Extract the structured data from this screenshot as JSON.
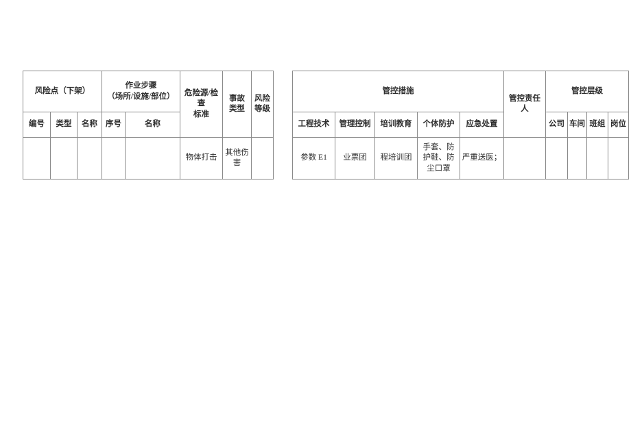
{
  "document": {
    "type": "risk-control-table",
    "background_color": "#ffffff",
    "border_color": "#8a8a8a",
    "text_color": "#2e2e2e"
  },
  "left_table": {
    "name": "risk-point-table",
    "headers": {
      "risk_point_group": "风险点（下架）",
      "risk_point_sub": [
        "编号",
        "类型",
        "名称"
      ],
      "work_step_group": "作业步骤\n（场所/设施/部位）",
      "work_step_group_line1": "作业步骤",
      "work_step_group_line2": "（场所/设施/部位）",
      "work_step_sub": [
        "序号",
        "名称"
      ],
      "hazard_source": "危险源/检查标准",
      "hazard_source_line1": "危险源/检查",
      "hazard_source_line2": "标准",
      "accident_type": "事故类型",
      "accident_type_line1": "事故",
      "accident_type_line2": "类型",
      "risk_level": "风险等级",
      "risk_level_line1": "风险",
      "risk_level_line2": "等级"
    },
    "rows": [
      {
        "number": "",
        "category": "",
        "name": "",
        "step_no": "",
        "step_name": "",
        "hazard_source": "物体打击",
        "accident_type": "其他伤害",
        "risk_level": ""
      }
    ]
  },
  "right_table": {
    "name": "control-measures-table",
    "headers": {
      "control_measures_group": "管控措施",
      "control_measures_sub": [
        "工程技术",
        "管理控制",
        "培训教育",
        "个体防护",
        "应急处置"
      ],
      "responsible_person": "管控责任人",
      "control_level_group": "管控层级",
      "control_level_sub": [
        "公司",
        "车间",
        "班组",
        "岗位"
      ]
    },
    "rows": [
      {
        "engineering": "参数 E1",
        "management": "业票团",
        "training": "程培训团",
        "ppe": "手套、防护鞋、防尘口罩",
        "emergency": "严重送医；",
        "responsible_person": "",
        "company": "",
        "workshop": "",
        "team": "",
        "position": ""
      }
    ]
  }
}
